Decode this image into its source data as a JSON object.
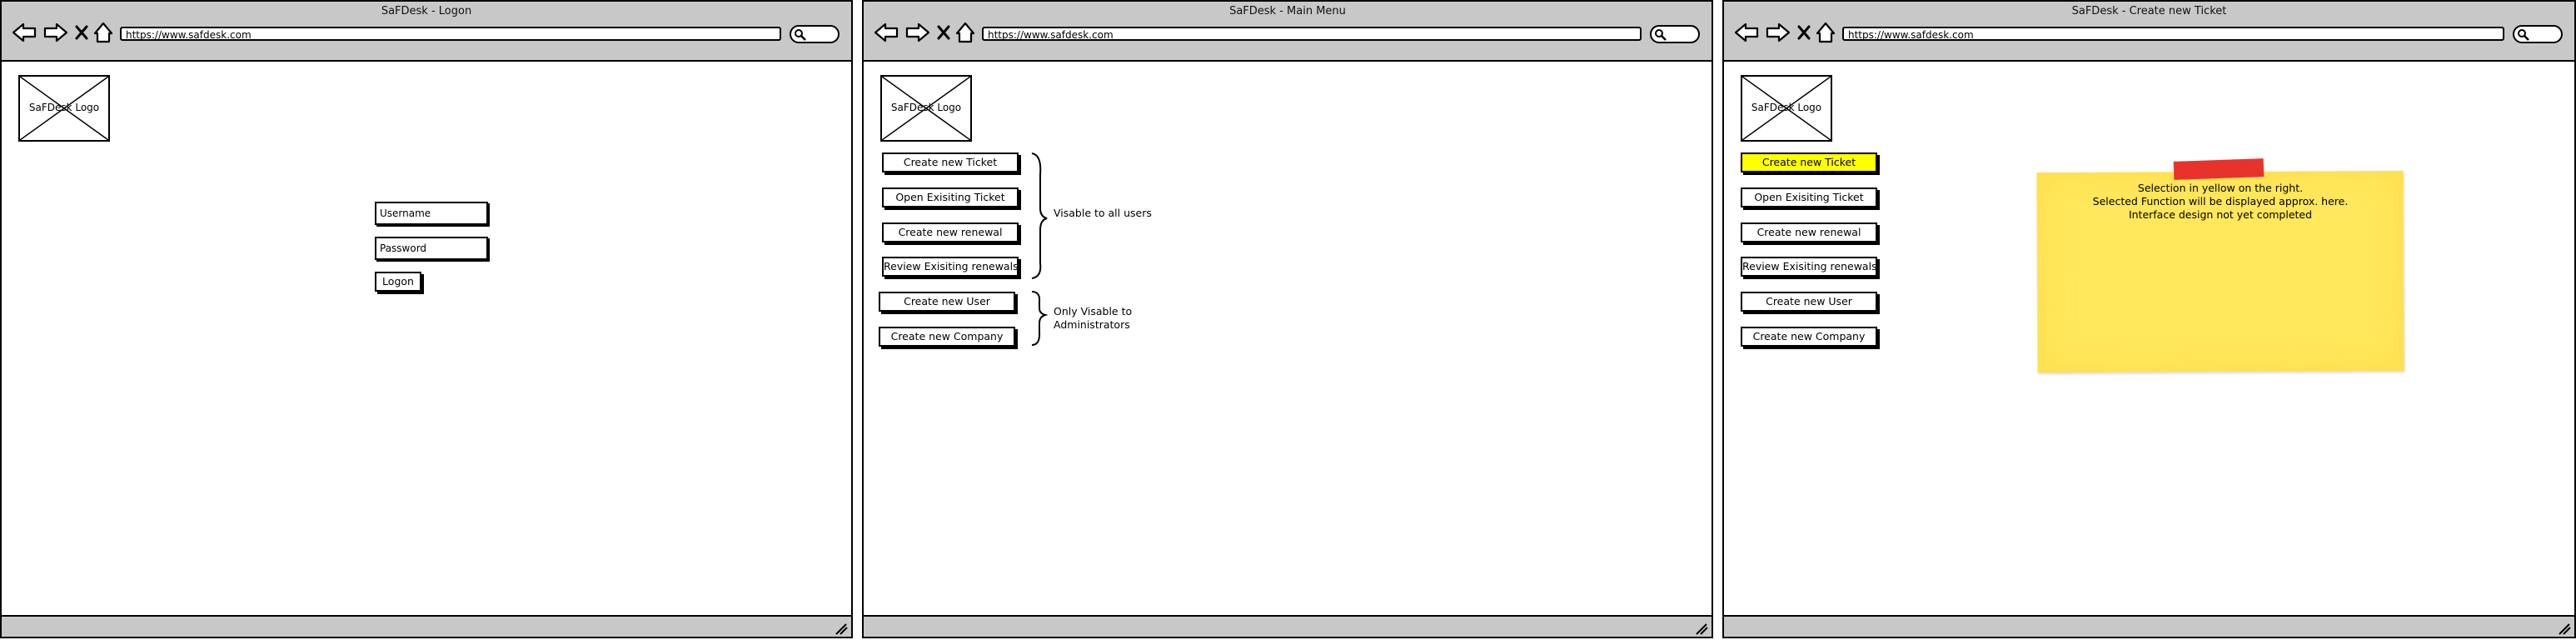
{
  "url": "https://www.safdesk.com",
  "logo_label": "SaFDesk Logo",
  "windows": {
    "logon": {
      "title": "SaFDesk - Logon",
      "username_label": "Username",
      "password_label": "Password",
      "logon_button": "Logon"
    },
    "main_menu": {
      "title": "SaFDesk - Main Menu",
      "buttons": [
        "Create new Ticket",
        "Open Exisiting Ticket",
        "Create new renewal",
        "Review Exisiting renewals",
        "Create new User",
        "Create new Company"
      ],
      "note_all": "Visable to all users",
      "note_admin_line1": "Only Visable to",
      "note_admin_line2": "Administrators"
    },
    "create_ticket": {
      "title": "SaFDesk - Create new Ticket",
      "buttons": [
        "Create new Ticket",
        "Open Exisiting Ticket",
        "Create new renewal",
        "Review Exisiting renewals",
        "Create new User",
        "Create new Company"
      ],
      "selected_color": "#ffff00",
      "sticky_line1": "Selection in yellow on the right.",
      "sticky_line2": "Selected Function will be displayed approx. here.",
      "sticky_line3": "Interface design not yet completed"
    }
  },
  "icons": [
    "back-arrow-icon",
    "forward-arrow-icon",
    "close-x-icon",
    "home-icon",
    "search-icon",
    "resize-grip-icon",
    "image-placeholder-icon"
  ]
}
